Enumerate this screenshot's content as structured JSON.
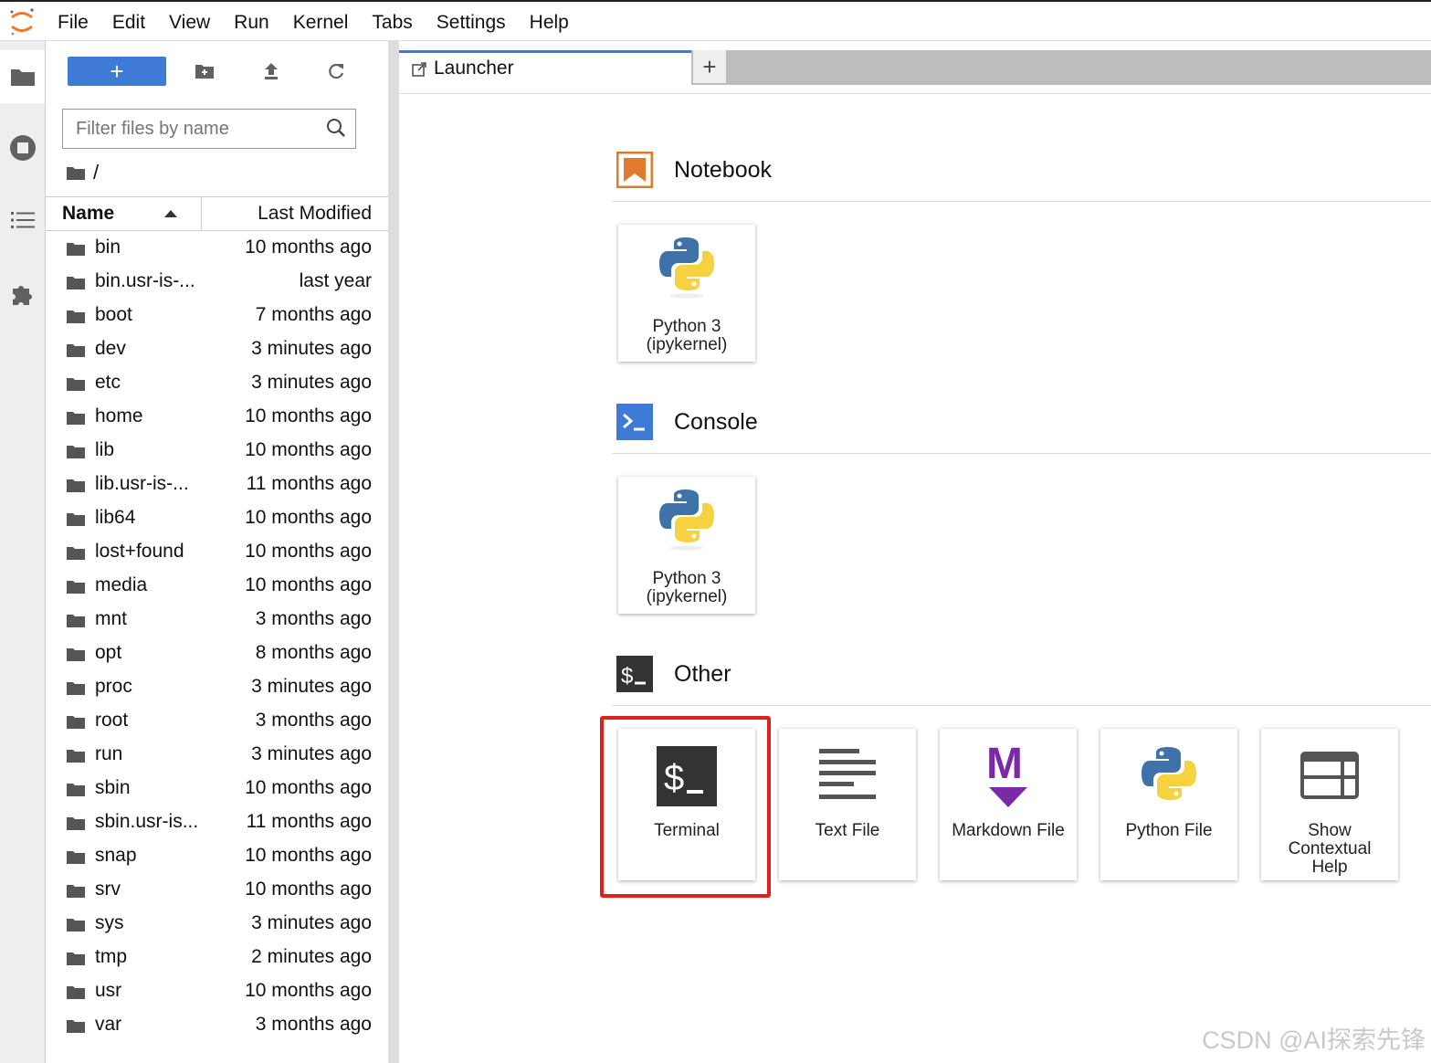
{
  "menu": [
    "File",
    "Edit",
    "View",
    "Run",
    "Kernel",
    "Tabs",
    "Settings",
    "Help"
  ],
  "filebrowser": {
    "new_label": "+",
    "filter_placeholder": "Filter files by name",
    "breadcrumb": "/",
    "col_name": "Name",
    "col_modified": "Last Modified",
    "files": [
      {
        "name": "bin",
        "modified": "10 months ago"
      },
      {
        "name": "bin.usr-is-...",
        "modified": "last year"
      },
      {
        "name": "boot",
        "modified": "7 months ago"
      },
      {
        "name": "dev",
        "modified": "3 minutes ago"
      },
      {
        "name": "etc",
        "modified": "3 minutes ago"
      },
      {
        "name": "home",
        "modified": "10 months ago"
      },
      {
        "name": "lib",
        "modified": "10 months ago"
      },
      {
        "name": "lib.usr-is-...",
        "modified": "11 months ago"
      },
      {
        "name": "lib64",
        "modified": "10 months ago"
      },
      {
        "name": "lost+found",
        "modified": "10 months ago"
      },
      {
        "name": "media",
        "modified": "10 months ago"
      },
      {
        "name": "mnt",
        "modified": "3 months ago"
      },
      {
        "name": "opt",
        "modified": "8 months ago"
      },
      {
        "name": "proc",
        "modified": "3 minutes ago"
      },
      {
        "name": "root",
        "modified": "3 months ago"
      },
      {
        "name": "run",
        "modified": "3 minutes ago"
      },
      {
        "name": "sbin",
        "modified": "10 months ago"
      },
      {
        "name": "sbin.usr-is...",
        "modified": "11 months ago"
      },
      {
        "name": "snap",
        "modified": "10 months ago"
      },
      {
        "name": "srv",
        "modified": "10 months ago"
      },
      {
        "name": "sys",
        "modified": "3 minutes ago"
      },
      {
        "name": "tmp",
        "modified": "2 minutes ago"
      },
      {
        "name": "usr",
        "modified": "10 months ago"
      },
      {
        "name": "var",
        "modified": "3 months ago"
      }
    ]
  },
  "tabs": {
    "launcher_label": "Launcher",
    "add_label": "+"
  },
  "launcher": {
    "notebook": {
      "title": "Notebook",
      "card_label": "Python 3\n(ipykernel)"
    },
    "console": {
      "title": "Console",
      "card_label": "Python 3\n(ipykernel)"
    },
    "other": {
      "title": "Other",
      "cards": [
        "Terminal",
        "Text File",
        "Markdown File",
        "Python File",
        "Show\nContextual\nHelp"
      ]
    }
  },
  "colors": {
    "accent": "#3f7bd6",
    "highlight": "#e0201c",
    "notebook": "#e07b2d",
    "terminal": "#333333",
    "markdown": "#7b2aa6"
  },
  "watermark": "CSDN @AI探索先锋"
}
